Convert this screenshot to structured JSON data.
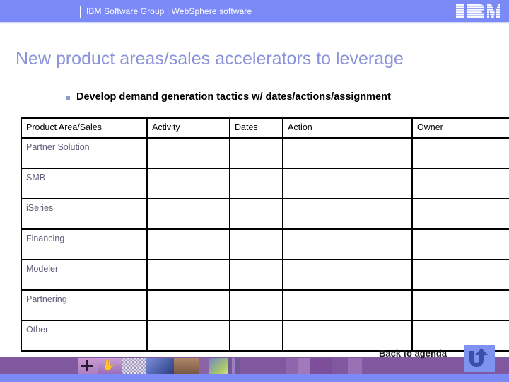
{
  "header": {
    "brand_text": "IBM Software Group | WebSphere software",
    "logo_name": "IBM",
    "band_color": "#7b8af7"
  },
  "title": {
    "text": "New product areas/sales accelerators to leverage",
    "color": "#8a92d9"
  },
  "bullet": {
    "text": "Develop demand generation tactics w/ dates/actions/assignment",
    "marker_color": "#8f9bd4"
  },
  "table": {
    "columns": [
      "Product Area/Sales",
      "Activity",
      "Dates",
      "Action",
      "Owner"
    ],
    "rows": [
      {
        "area": "Partner Solution",
        "activity": "",
        "dates": "",
        "action": "",
        "owner": ""
      },
      {
        "area": "SMB",
        "activity": "",
        "dates": "",
        "action": "",
        "owner": ""
      },
      {
        "area": "iSeries",
        "activity": "",
        "dates": "",
        "action": "",
        "owner": ""
      },
      {
        "area": "Financing",
        "activity": "",
        "dates": "",
        "action": "",
        "owner": ""
      },
      {
        "area": "Modeler",
        "activity": "",
        "dates": "",
        "action": "",
        "owner": ""
      },
      {
        "area": "Partnering",
        "activity": "",
        "dates": "",
        "action": "",
        "owner": ""
      },
      {
        "area": "Other",
        "activity": "",
        "dates": "",
        "action": "",
        "owner": ""
      }
    ]
  },
  "footer": {
    "back_link_label": "Back to agenda",
    "arrow_icon_name": "u-turn-arrow-icon",
    "purple_band_color": "#8058a0",
    "blue_strip_color": "#7b8af7"
  }
}
